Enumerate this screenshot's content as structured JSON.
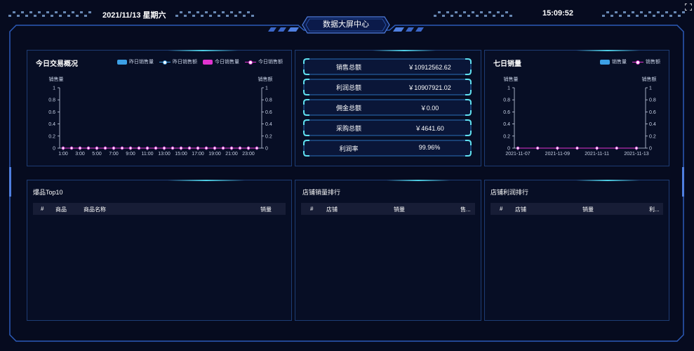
{
  "header": {
    "date": "2021/11/13 星期六",
    "time": "15:09:52",
    "title": "数据大屏中心"
  },
  "today_panel": {
    "title": "今日交易概况",
    "legend": [
      "昨日销售量",
      "昨日销售额",
      "今日销售量",
      "今日销售额"
    ],
    "ylabel_left": "销售量",
    "ylabel_right": "销售额"
  },
  "kpis": [
    {
      "label": "销售总额",
      "value": "￥10912562.62"
    },
    {
      "label": "利润总额",
      "value": "￥10907921.02"
    },
    {
      "label": "佣金总额",
      "value": "￥0.00"
    },
    {
      "label": "采购总额",
      "value": "￥4641.60"
    },
    {
      "label": "利润率",
      "value": "99.96%"
    }
  ],
  "week_panel": {
    "title": "七日销量",
    "legend": [
      "销售量",
      "销售额"
    ],
    "ylabel_left": "销售量",
    "ylabel_right": "销售额"
  },
  "top10_panel": {
    "title": "爆品Top10",
    "columns": [
      "#",
      "商品",
      "商品名称",
      "销量"
    ]
  },
  "shop_sales_panel": {
    "title": "店铺销量排行",
    "columns": [
      "#",
      "店铺",
      "销量",
      "售..."
    ]
  },
  "shop_profit_panel": {
    "title": "店铺利润排行",
    "columns": [
      "#",
      "店铺",
      "销量",
      "利..."
    ]
  },
  "colors": {
    "accent": "#4fd0e6",
    "bar_blue": "#3ca0e6",
    "magenta": "#e033d0",
    "frame": "#2c5bb8"
  },
  "chart_data": [
    {
      "type": "line",
      "title": "今日交易概况",
      "x": [
        "1:00",
        "2:00",
        "3:00",
        "4:00",
        "5:00",
        "6:00",
        "7:00",
        "8:00",
        "9:00",
        "10:00",
        "11:00",
        "12:00",
        "13:00",
        "14:00",
        "15:00",
        "16:00",
        "17:00",
        "18:00",
        "19:00",
        "20:00",
        "21:00",
        "22:00",
        "23:00",
        "24:00"
      ],
      "x_tick_labels": [
        "1:00",
        "3:00",
        "5:00",
        "7:00",
        "9:00",
        "11:00",
        "13:00",
        "15:00",
        "17:00",
        "19:00",
        "21:00",
        "23:00"
      ],
      "series": [
        {
          "name": "昨日销售量",
          "values": [
            0,
            0,
            0,
            0,
            0,
            0,
            0,
            0,
            0,
            0,
            0,
            0,
            0,
            0,
            0,
            0,
            0,
            0,
            0,
            0,
            0,
            0,
            0,
            0
          ]
        },
        {
          "name": "昨日销售额",
          "values": [
            0,
            0,
            0,
            0,
            0,
            0,
            0,
            0,
            0,
            0,
            0,
            0,
            0,
            0,
            0,
            0,
            0,
            0,
            0,
            0,
            0,
            0,
            0,
            0
          ]
        },
        {
          "name": "今日销售量",
          "values": [
            0,
            0,
            0,
            0,
            0,
            0,
            0,
            0,
            0,
            0,
            0,
            0,
            0,
            0,
            0,
            0,
            0,
            0,
            0,
            0,
            0,
            0,
            0,
            0
          ]
        },
        {
          "name": "今日销售额",
          "values": [
            0,
            0,
            0,
            0,
            0,
            0,
            0,
            0,
            0,
            0,
            0,
            0,
            0,
            0,
            0,
            0,
            0,
            0,
            0,
            0,
            0,
            0,
            0,
            0
          ]
        }
      ],
      "ylabel": "销售量",
      "y2label": "销售额",
      "ylim": [
        0,
        1
      ],
      "y_ticks": [
        "0",
        "0.2",
        "0.4",
        "0.6",
        "0.8",
        "1"
      ],
      "legend_position": "top-right"
    },
    {
      "type": "line",
      "title": "七日销量",
      "x": [
        "2021-11-07",
        "2021-11-08",
        "2021-11-09",
        "2021-11-10",
        "2021-11-11",
        "2021-11-12",
        "2021-11-13"
      ],
      "x_tick_labels": [
        "2021-11-07",
        "2021-11-09",
        "2021-11-11",
        "2021-11-13"
      ],
      "series": [
        {
          "name": "销售量",
          "values": [
            0,
            0,
            0,
            0,
            0,
            0,
            0
          ]
        },
        {
          "name": "销售额",
          "values": [
            0,
            0,
            0,
            0,
            0,
            0,
            0
          ]
        }
      ],
      "ylabel": "销售量",
      "y2label": "销售额",
      "ylim": [
        0,
        1
      ],
      "y_ticks": [
        "0",
        "0.2",
        "0.4",
        "0.6",
        "0.8",
        "1"
      ],
      "legend_position": "top-right"
    }
  ]
}
